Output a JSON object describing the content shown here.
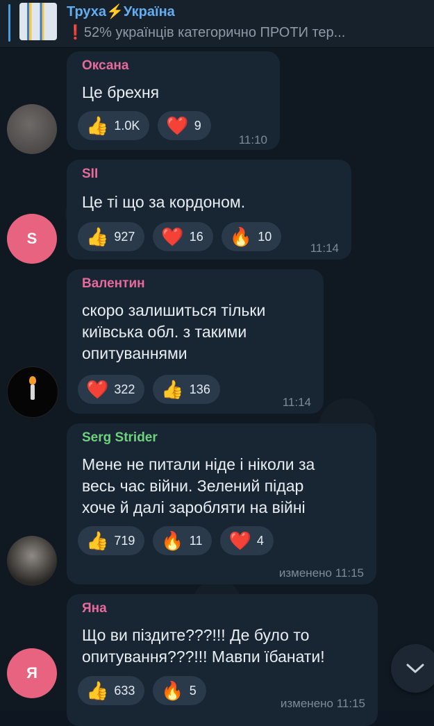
{
  "pinned": {
    "channel_title": "Труха⚡Україна",
    "message_preview": "❗52% українців категорично ПРОТИ тер..."
  },
  "messages": [
    {
      "sender": "Оксана",
      "sender_color": "#e86a9c",
      "text": "Це брехня",
      "reactions": [
        {
          "emoji": "👍",
          "count": "1.0K"
        },
        {
          "emoji": "❤️",
          "count": "9"
        }
      ],
      "time": "11:10"
    },
    {
      "sender": "SII",
      "sender_color": "#e86a9c",
      "avatar_letter": "S",
      "text": "Це ті що за кордоном.",
      "reactions": [
        {
          "emoji": "👍",
          "count": "927"
        },
        {
          "emoji": "❤️",
          "count": "16"
        },
        {
          "emoji": "🔥",
          "count": "10"
        }
      ],
      "time": "11:14"
    },
    {
      "sender": "Валентин",
      "sender_color": "#e86a9c",
      "text_lines": [
        "скоро залишиться тільки",
        "київська обл. з такими",
        "опитуваннями"
      ],
      "reactions": [
        {
          "emoji": "❤️",
          "count": "322"
        },
        {
          "emoji": "👍",
          "count": "136"
        }
      ],
      "time": "11:14"
    },
    {
      "sender": "Serg Strider",
      "sender_color": "#6fd27c",
      "text_lines": [
        "Мене не питали ніде і ніколи за",
        "весь час війни. Зелений підар",
        "хоче й далі заробляти на війні"
      ],
      "reactions": [
        {
          "emoji": "👍",
          "count": "719"
        },
        {
          "emoji": "🔥",
          "count": "11"
        },
        {
          "emoji": "❤️",
          "count": "4"
        }
      ],
      "time": "изменено 11:15"
    },
    {
      "sender": "Яна",
      "sender_color": "#e86a9c",
      "avatar_letter": "Я",
      "text_lines": [
        "Що ви піздите???!!! Де було то",
        "опитування???!!! Мавпи їбанати!"
      ],
      "reactions": [
        {
          "emoji": "👍",
          "count": "633"
        },
        {
          "emoji": "🔥",
          "count": "5"
        }
      ],
      "time": "изменено 11:15"
    }
  ],
  "colors": {
    "background": "#0e1621",
    "bubble": "#182533",
    "reaction_pill": "#2a3a4b",
    "pinned_title": "#62aef0",
    "avatar_pink": "#e8637f"
  },
  "icons": {
    "scroll_down": "chevron-down-icon"
  }
}
